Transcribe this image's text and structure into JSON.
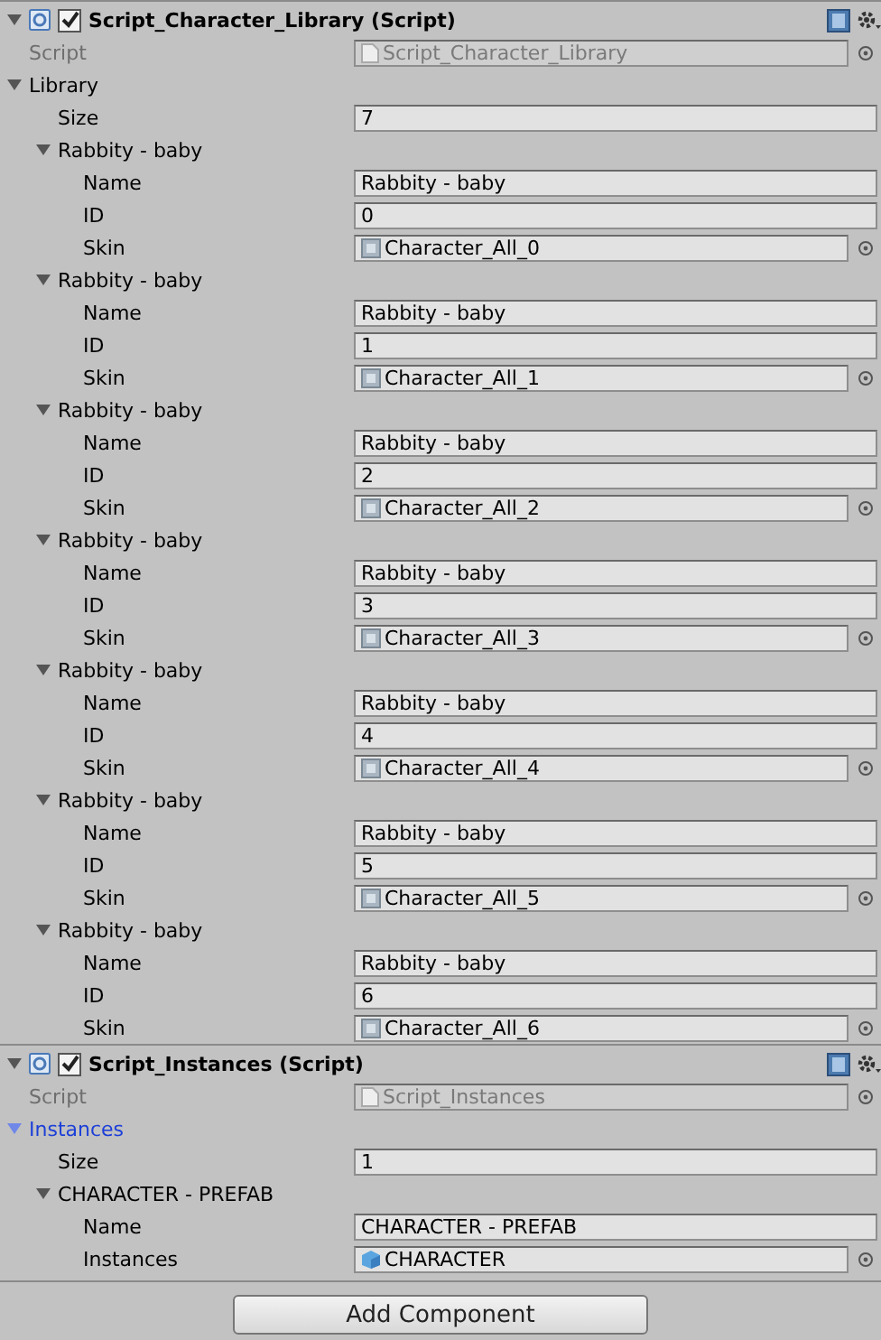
{
  "components": [
    {
      "title": "Script_Character_Library (Script)",
      "enabled": true,
      "expanded": true,
      "script": {
        "label": "Script",
        "value": "Script_Character_Library"
      },
      "list": {
        "label": "Library",
        "expanded": true,
        "selected": false,
        "size_label": "Size",
        "size": "7",
        "elements": [
          {
            "label": "Rabbity - baby",
            "expanded": true,
            "fields": [
              {
                "kind": "text",
                "label": "Name",
                "value": "Rabbity - baby"
              },
              {
                "kind": "text",
                "label": "ID",
                "value": "0"
              },
              {
                "kind": "sprite",
                "label": "Skin",
                "value": "Character_All_0"
              }
            ]
          },
          {
            "label": "Rabbity - baby",
            "expanded": true,
            "fields": [
              {
                "kind": "text",
                "label": "Name",
                "value": "Rabbity - baby"
              },
              {
                "kind": "text",
                "label": "ID",
                "value": "1"
              },
              {
                "kind": "sprite",
                "label": "Skin",
                "value": "Character_All_1"
              }
            ]
          },
          {
            "label": "Rabbity - baby",
            "expanded": true,
            "fields": [
              {
                "kind": "text",
                "label": "Name",
                "value": "Rabbity - baby"
              },
              {
                "kind": "text",
                "label": "ID",
                "value": "2"
              },
              {
                "kind": "sprite",
                "label": "Skin",
                "value": "Character_All_2"
              }
            ]
          },
          {
            "label": "Rabbity - baby",
            "expanded": true,
            "fields": [
              {
                "kind": "text",
                "label": "Name",
                "value": "Rabbity - baby"
              },
              {
                "kind": "text",
                "label": "ID",
                "value": "3"
              },
              {
                "kind": "sprite",
                "label": "Skin",
                "value": "Character_All_3"
              }
            ]
          },
          {
            "label": "Rabbity - baby",
            "expanded": true,
            "fields": [
              {
                "kind": "text",
                "label": "Name",
                "value": "Rabbity - baby"
              },
              {
                "kind": "text",
                "label": "ID",
                "value": "4"
              },
              {
                "kind": "sprite",
                "label": "Skin",
                "value": "Character_All_4"
              }
            ]
          },
          {
            "label": "Rabbity - baby",
            "expanded": true,
            "fields": [
              {
                "kind": "text",
                "label": "Name",
                "value": "Rabbity - baby"
              },
              {
                "kind": "text",
                "label": "ID",
                "value": "5"
              },
              {
                "kind": "sprite",
                "label": "Skin",
                "value": "Character_All_5"
              }
            ]
          },
          {
            "label": "Rabbity - baby",
            "expanded": true,
            "fields": [
              {
                "kind": "text",
                "label": "Name",
                "value": "Rabbity - baby"
              },
              {
                "kind": "text",
                "label": "ID",
                "value": "6"
              },
              {
                "kind": "sprite",
                "label": "Skin",
                "value": "Character_All_6"
              }
            ]
          }
        ]
      }
    },
    {
      "title": "Script_Instances (Script)",
      "enabled": true,
      "expanded": true,
      "script": {
        "label": "Script",
        "value": "Script_Instances"
      },
      "list": {
        "label": "Instances",
        "expanded": true,
        "selected": true,
        "size_label": "Size",
        "size": "1",
        "elements": [
          {
            "label": "CHARACTER - PREFAB",
            "expanded": true,
            "fields": [
              {
                "kind": "text",
                "label": "Name",
                "value": "CHARACTER - PREFAB"
              },
              {
                "kind": "prefab",
                "label": "Instances",
                "value": "CHARACTER"
              }
            ]
          }
        ]
      }
    }
  ],
  "add_button": "Add Component"
}
